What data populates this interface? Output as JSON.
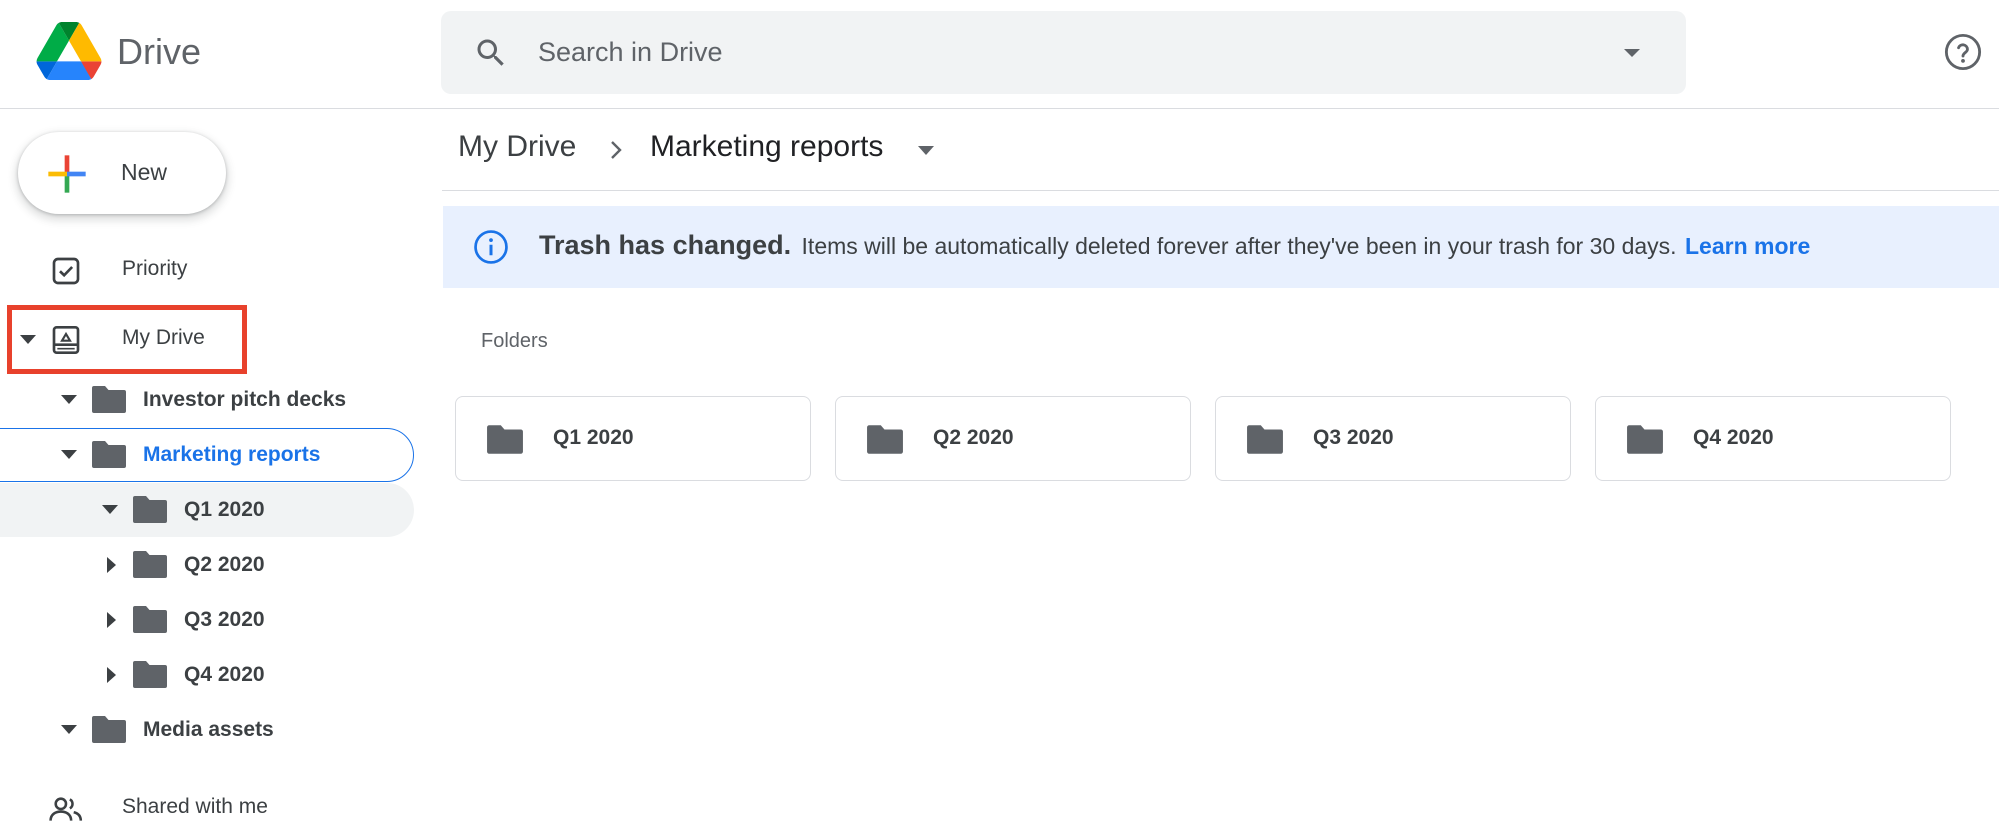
{
  "app": {
    "brand": "Drive"
  },
  "search": {
    "placeholder": "Search in Drive"
  },
  "sidebar": {
    "new_label": "New",
    "priority_label": "Priority",
    "my_drive_label": "My Drive",
    "tree": [
      {
        "label": "Investor pitch decks",
        "expanded": true
      },
      {
        "label": "Marketing reports",
        "expanded": true,
        "selected": true
      },
      {
        "label": "Q1 2020",
        "expanded": true
      },
      {
        "label": "Q2 2020",
        "expanded": false
      },
      {
        "label": "Q3 2020",
        "expanded": false
      },
      {
        "label": "Q4 2020",
        "expanded": false
      },
      {
        "label": "Media assets",
        "expanded": true
      }
    ],
    "shared_label": "Shared with me"
  },
  "breadcrumb": {
    "root": "My Drive",
    "current": "Marketing reports"
  },
  "banner": {
    "title": "Trash has changed.",
    "body": "Items will be automatically deleted forever after they've been in your trash for 30 days.",
    "link": "Learn more"
  },
  "main": {
    "section_label": "Folders",
    "folders": [
      {
        "label": "Q1 2020"
      },
      {
        "label": "Q2 2020"
      },
      {
        "label": "Q3 2020"
      },
      {
        "label": "Q4 2020"
      }
    ]
  },
  "colors": {
    "accent": "#1a73e8",
    "highlight": "#e8412c",
    "banner_bg": "#e8f0fe",
    "folder_icon": "#5f6368"
  },
  "icons": [
    "drive-logo-icon",
    "search-icon",
    "caret-down-icon",
    "help-icon",
    "plus-icon",
    "priority-icon",
    "my-drive-icon",
    "folder-icon",
    "info-icon",
    "shared-icon"
  ]
}
